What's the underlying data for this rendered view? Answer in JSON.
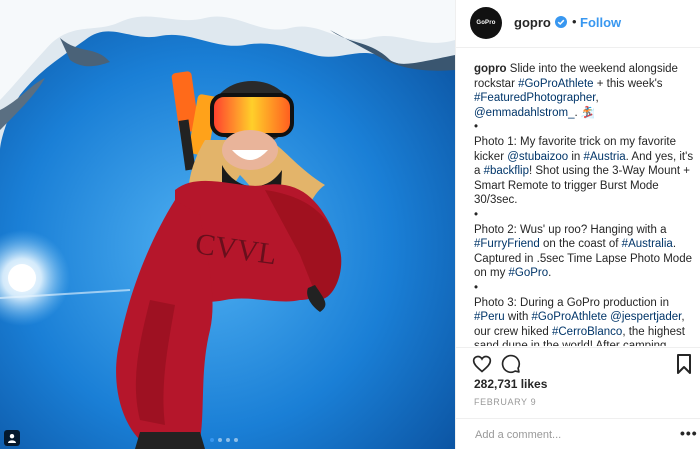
{
  "post": {
    "username": "gopro",
    "avatar_text": "GoPro",
    "follow_label": "Follow",
    "separator": "•",
    "likes": "282,731 likes",
    "date": "FEBRUARY 9",
    "add_comment_placeholder": "Add a comment...",
    "more_label": "•••",
    "carousel": {
      "count": 4,
      "active_index": 0
    }
  },
  "caption": {
    "user": "gopro",
    "intro": [
      {
        "t": " Slide into the weekend alongside rockstar "
      },
      {
        "t": "#GoProAthlete",
        "tag": true
      },
      {
        "t": " + this week's "
      },
      {
        "t": "#FeaturedPhotographer",
        "tag": true
      },
      {
        "t": ", "
      },
      {
        "t": "@emmadahlstrom_",
        "tag": true
      },
      {
        "t": ". 🏂"
      }
    ],
    "bullet": "•",
    "photo1": [
      {
        "t": "Photo 1: My favorite trick on my favorite kicker "
      },
      {
        "t": "@stubaizoo",
        "tag": true
      },
      {
        "t": " in "
      },
      {
        "t": "#Austria",
        "tag": true
      },
      {
        "t": ". And yes, it's a "
      },
      {
        "t": "#backflip",
        "tag": true
      },
      {
        "t": "! Shot using the 3-Way Mount + Smart Remote to trigger Burst Mode 30/3sec."
      }
    ],
    "photo2": [
      {
        "t": "Photo 2: Wus' up roo? Hanging with a "
      },
      {
        "t": "#FurryFriend",
        "tag": true
      },
      {
        "t": " on the coast of "
      },
      {
        "t": "#Australia",
        "tag": true
      },
      {
        "t": ". Captured in .5sec Time Lapse Photo Mode on my "
      },
      {
        "t": "#GoPro",
        "tag": true
      },
      {
        "t": "."
      }
    ],
    "photo3": [
      {
        "t": "Photo 3: During a GoPro production in "
      },
      {
        "t": "#Peru",
        "tag": true
      },
      {
        "t": " with "
      },
      {
        "t": "#GoProAthlete",
        "tag": true
      },
      {
        "t": " "
      },
      {
        "t": "@jespertjader",
        "tag": true
      },
      {
        "t": ", our crew hiked "
      },
      {
        "t": "#CerroBlanco",
        "tag": true
      },
      {
        "t": ", the highest sand dune in the world! After camping overnight at"
      }
    ]
  },
  "colors": {
    "link": "#003569",
    "follow": "#3897f0",
    "verified": "#3897f0",
    "jacket": "#b5162b",
    "sky": "#1a7fd6"
  },
  "icons": [
    "verified-badge-icon",
    "heart-icon",
    "comment-icon",
    "bookmark-icon",
    "user-tag-icon",
    "more-options-icon"
  ]
}
